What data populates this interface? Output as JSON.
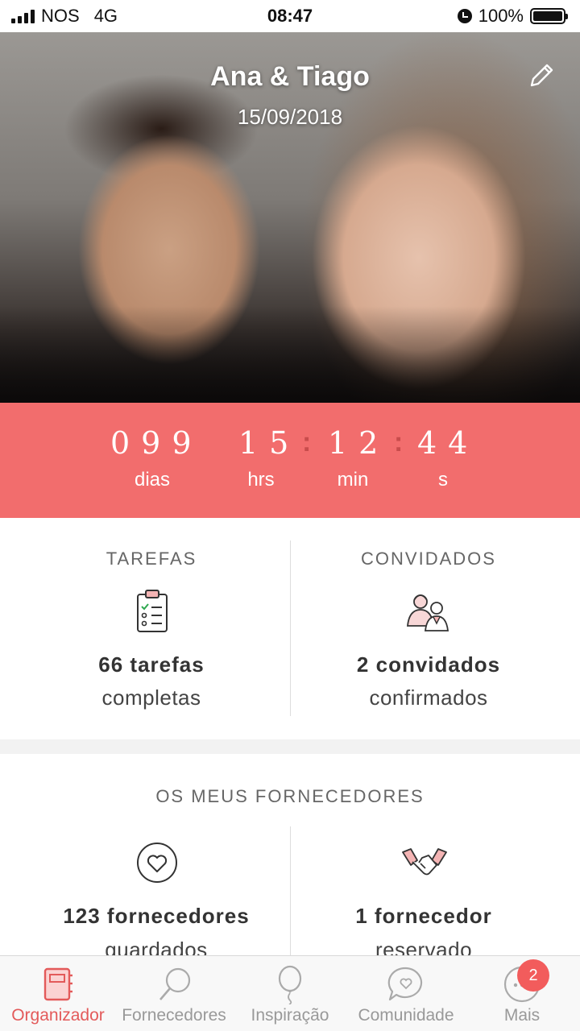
{
  "status_bar": {
    "carrier": "NOS",
    "network": "4G",
    "time": "08:47",
    "battery": "100%"
  },
  "hero": {
    "title": "Ana & Tiago",
    "date": "15/09/2018"
  },
  "countdown": {
    "days": "099",
    "hours": "15",
    "minutes": "12",
    "seconds": "44",
    "days_label": "dias",
    "hours_label": "hrs",
    "minutes_label": "min",
    "seconds_label": "s"
  },
  "tasks": {
    "header": "TAREFAS",
    "count": "66 tarefas",
    "status": "completas"
  },
  "guests": {
    "header": "CONVIDADOS",
    "count": "2 convidados",
    "status": "confirmados"
  },
  "suppliers": {
    "title": "OS MEUS FORNECEDORES",
    "saved_count": "123 fornecedores",
    "saved_status": "guardados",
    "booked_count": "1 fornecedor",
    "booked_status": "reservado"
  },
  "tabbar": {
    "items": [
      {
        "label": "Organizador",
        "icon": "planner-icon",
        "active": true
      },
      {
        "label": "Fornecedores",
        "icon": "search-icon"
      },
      {
        "label": "Inspiração",
        "icon": "balloon-icon"
      },
      {
        "label": "Comunidade",
        "icon": "chat-heart-icon"
      },
      {
        "label": "Mais",
        "icon": "more-icon",
        "badge": "2"
      }
    ]
  },
  "colors": {
    "accent": "#f26d6d",
    "active_tab": "#e35a5a"
  }
}
